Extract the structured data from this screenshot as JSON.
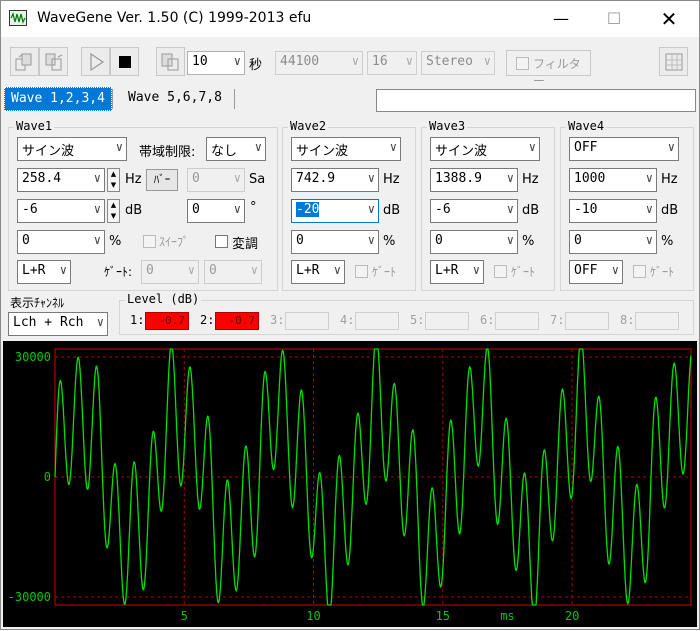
{
  "window": {
    "title": "WaveGene  Ver. 1.50  (C) 1999-2013 efu"
  },
  "toolbar": {
    "duration": "10",
    "duration_unit": "秒",
    "sample_rate": "44100",
    "bit_depth": "16",
    "channels": "Stereo",
    "filter_label": "フィルター"
  },
  "tabs": [
    {
      "label": "Wave 1,2,3,4"
    },
    {
      "label": "Wave 5,6,7,8"
    }
  ],
  "waves": [
    {
      "title": "Wave1",
      "type": "サイン波",
      "freq": "258.4",
      "level": "-6",
      "phase": "0",
      "pan": "L+R"
    },
    {
      "title": "Wave2",
      "type": "サイン波",
      "freq": "742.9",
      "level": "-20",
      "phase": "0",
      "pan": "L+R"
    },
    {
      "title": "Wave3",
      "type": "サイン波",
      "freq": "1388.9",
      "level": "-6",
      "phase": "0",
      "pan": "L+R"
    },
    {
      "title": "Wave4",
      "type": "OFF",
      "freq": "1000",
      "level": "-10",
      "phase": "0",
      "pan": "OFF"
    }
  ],
  "wave1_extra": {
    "bandlimit_label": "帯域制限:",
    "bandlimit_value": "なし",
    "burst_label": "ﾊﾞｰ",
    "burst_value": "0",
    "sa_unit": "Sa",
    "phase_value": "0",
    "deg_unit": "°",
    "sweep_label": "ｽｲｰﾌﾟ",
    "mod_label": "変調",
    "gate_label": "ｹﾞｰﾄ:",
    "gate_a": "0",
    "gate_b": "0"
  },
  "units": {
    "hz": "Hz",
    "db": "dB",
    "pct": "%"
  },
  "gate_label": "ｹﾞｰﾄ",
  "display": {
    "label": "表示ﾁｬﾝﾈﾙ",
    "value": "Lch + Rch"
  },
  "level": {
    "title": "Level (dB)",
    "meters": [
      {
        "label": "1:",
        "value": "-0.7"
      },
      {
        "label": "2:",
        "value": "-0.7"
      },
      {
        "label": "3:",
        "value": ""
      },
      {
        "label": "4:",
        "value": ""
      },
      {
        "label": "5:",
        "value": ""
      },
      {
        "label": "6:",
        "value": ""
      },
      {
        "label": "7:",
        "value": ""
      },
      {
        "label": "8:",
        "value": ""
      }
    ]
  },
  "scope": {
    "y_ticks": [
      "30000",
      "0",
      "-30000"
    ],
    "x_ticks": [
      "5",
      "10",
      "15",
      "20"
    ],
    "x_unit": "ms",
    "colors": {
      "trace": "#00e000",
      "frame": "#d00000",
      "grid": "#b00000",
      "text": "#00c800"
    }
  },
  "chart_data": {
    "type": "line",
    "title": "",
    "xlabel": "ms",
    "ylabel": "",
    "xlim": [
      0,
      24.6
    ],
    "ylim": [
      -32000,
      32000
    ],
    "x_ticks": [
      5,
      10,
      15,
      20
    ],
    "y_ticks": [
      30000,
      0,
      -30000
    ],
    "grid": true,
    "series": [
      {
        "components": [
          {
            "freq_hz": 258.4,
            "level_db": -6
          },
          {
            "freq_hz": 742.9,
            "level_db": -20
          },
          {
            "freq_hz": 1388.9,
            "level_db": -6
          }
        ]
      }
    ]
  }
}
